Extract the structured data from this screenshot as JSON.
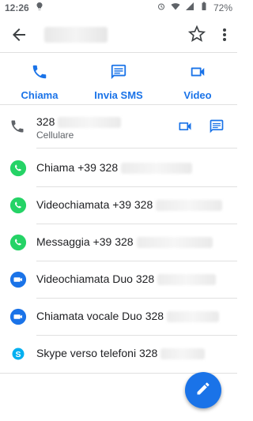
{
  "status": {
    "time": "12:26",
    "battery": "72%"
  },
  "actions": [
    {
      "label": "Chiama",
      "icon": "phone-icon"
    },
    {
      "label": "Invia SMS",
      "icon": "message-icon"
    },
    {
      "label": "Video",
      "icon": "videocam-icon"
    }
  ],
  "phone": {
    "number": "328",
    "type": "Cellulare"
  },
  "rows": [
    {
      "label": "Chiama +39 328",
      "icon": "whatsapp-icon"
    },
    {
      "label": "Videochiamata +39 328",
      "icon": "whatsapp-icon"
    },
    {
      "label": "Messaggia +39 328",
      "icon": "whatsapp-icon"
    },
    {
      "label": "Videochiamata Duo 328",
      "icon": "duo-icon"
    },
    {
      "label": "Chiamata vocale Duo 328",
      "icon": "duo-icon"
    },
    {
      "label": "Skype verso telefoni 328",
      "icon": "skype-icon"
    }
  ],
  "colors": {
    "accent": "#1a73e8",
    "whatsapp": "#25d366",
    "duo": "#1a73e8",
    "skype": "#00aff0"
  }
}
